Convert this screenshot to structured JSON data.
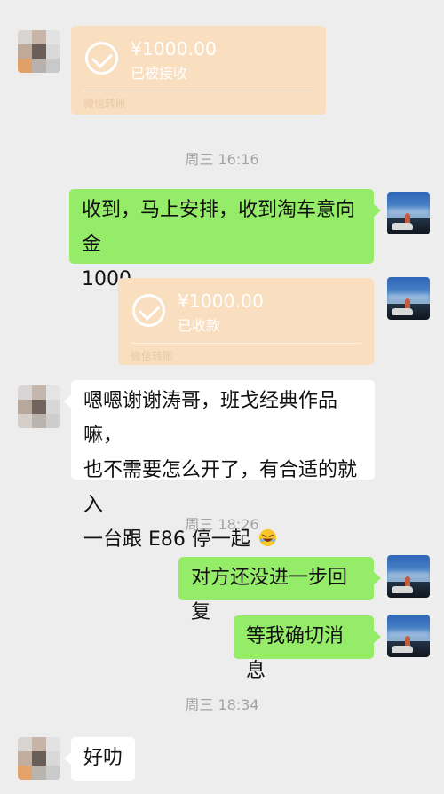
{
  "messages": {
    "transfer_1": {
      "amount": "¥1000.00",
      "status": "已被接收",
      "footer": "微信转账"
    },
    "time_1": "周三 16:16",
    "msg_1": {
      "line1": "收到，马上安排，收到淘车意向金",
      "line2": "1000"
    },
    "transfer_2": {
      "amount": "¥1000.00",
      "status": "已收款",
      "footer": "微信转账"
    },
    "msg_2": {
      "line1": "嗯嗯谢谢涛哥，班戈经典作品嘛，",
      "line2": "也不需要怎么开了，有合适的就入",
      "line3": "一台跟 E86 停一起"
    },
    "time_2": "周三 18:26",
    "msg_3": "对方还没进一步回复",
    "msg_4": "等我确切消息",
    "time_3": "周三 18:34",
    "msg_5": "好叻"
  },
  "colors": {
    "background": "#ededed",
    "sent_bubble": "#95ec69",
    "received_bubble": "#ffffff",
    "transfer_card": "#f9dfbf",
    "timestamp": "#a3a3a3"
  },
  "icons": [
    "check-icon",
    "laughing-emoji-icon"
  ]
}
